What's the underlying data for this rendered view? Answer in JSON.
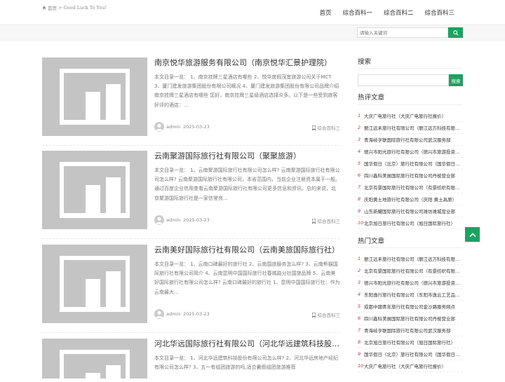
{
  "nav": {
    "items": [
      "首页",
      "综合百科一",
      "综合百科二",
      "综合百科三"
    ]
  },
  "breadcrumb": {
    "home": "首页",
    "separator": ">",
    "current": "Good Luck To You!"
  },
  "top_search": {
    "placeholder": "请输入关键词"
  },
  "posts": [
    {
      "title": "南京悦华旅游服务有限公司（南京悦华汇景护理院）",
      "excerpt": "本文目录一览： 1、南京挂牌三星酒店有哪些 2、悦华度假茂宜旅游公司关于MCT 3、厦门建发旅游集团股份有限公司概况 4、厦门建发旅游集团股份有限公司品牌介绍 南京挂牌三星酒店有哪些 您好，南京挂牌三星级酒店选择众多。以下是一些受到旅客好评的酒店：...",
      "author": "admin",
      "date": "2025-03-23",
      "category": "综合百科三"
    },
    {
      "title": "云南聚游国际旅行社有限公司（聚聚旅游）",
      "excerpt": "本文目录一览： 1、云南聚游国际旅行社有限公司怎么样? 云南聚游国际旅行社有限公司怎么样? 云南聚游国际旅行社有限公司，本省范围内，当前企业注册资本属于一般。通过百度企业信用查看云南聚游国际旅行社有限公司更多信息和资讯。总的来说，北京聚游国际旅行社是一家信誉良...",
      "author": "admin",
      "date": "2025-03-23",
      "category": "综合百科三"
    },
    {
      "title": "云南美好国际旅行社有限公司（云南美旅国际旅行社）",
      "excerpt": "本文目录一览： 1、云南口碑最好的旅行社 2、云南国旅服务怎么样? 3、云南熊猫国际旅行社有限公司简介 4、云南昆明中国国际旅行社春城路分社国旅品牌 5、云南美好国际旅行社有限公司怎么样? 云南口碑最好的旅行社 1、昆明中国国际旅行社：作为云南最大...",
      "author": "admin",
      "date": "2025-03-23",
      "category": "综合百科三"
    },
    {
      "title": "河北华远国际旅行社有限公司（河北华远建筑科技股份有限公司）",
      "excerpt": "本文目录一览： 1、河北华远建筑科技股份有限公司怎么样? 2、河北华远房地产经纪有限公司怎么样? 3、五一有组团旅游的吗,适合暑假组团旅游推荐",
      "author": "admin",
      "date": "2025-03-23",
      "category": "综合百科三"
    }
  ],
  "sidebar": {
    "search_title": "搜索",
    "search_button": "搜索",
    "hot_comments_title": "热评文章",
    "hot_comments": [
      {
        "num": "1",
        "text": "大庆广电旅行社（大庆广电旅行社报价）"
      },
      {
        "num": "2",
        "text": "丽江远禾旅行社有限公司（丽江远方科技有限公司）"
      },
      {
        "num": "3",
        "text": "青海岐亨联国际旅行社有限公司武汉服务部"
      },
      {
        "num": "4",
        "text": "德兴市阳光旅行社有限公司（德兴市旅游投资公司）"
      },
      {
        "num": "5",
        "text": "国华假日（北京）旅行社有限公司（国华假日旅行社）"
      },
      {
        "num": "6",
        "text": "四川鑫科美展国际旅行社有限公司丹棱营业部"
      },
      {
        "num": "7",
        "text": "北京有景国际旅行社有限公司（有景纺织有限公司）"
      },
      {
        "num": "8",
        "text": "庆阳黄土地旅行社有限公司（庆阳 黄土高原）"
      },
      {
        "num": "9",
        "text": "山东新耀国际旅行社有限公司潍坊潍城营业部"
      },
      {
        "num": "10",
        "text": "北京旭日旅行社有限公司（旭日国际旅行社）"
      }
    ],
    "hot_posts_title": "热门文章",
    "hot_posts": [
      {
        "num": "1",
        "text": "丽江远禾旅行社有限公司（丽江远方科技有限公司）"
      },
      {
        "num": "2",
        "text": "北京有景国际旅行社有限公司（有景纺织有限公司）"
      },
      {
        "num": "3",
        "text": "德兴市阳光旅行社有限公司（德兴市旅游投资公司）"
      },
      {
        "num": "4",
        "text": "东阳逸行旅行社有限公司（东阳市逸云工艺品有限公司）"
      },
      {
        "num": "5",
        "text": "成都中國青年旅行社有限公司金沙路服务网点"
      },
      {
        "num": "6",
        "text": "四川鑫科美展国际旅行社有限公司丹棱营业部"
      },
      {
        "num": "7",
        "text": "青海岐亨联国际旅行社有限公司武汉服务部"
      },
      {
        "num": "8",
        "text": "北京旭日旅行社有限公司（旭日国际旅行社）"
      },
      {
        "num": "9",
        "text": "国华假日（北京）旅行社有限公司（国华假日旅行社）"
      },
      {
        "num": "10",
        "text": "大庆广电旅行社（大庆广电旅行社报价）"
      }
    ]
  },
  "colors": {
    "accent": "#1aa361",
    "rank_num": "#c0392b",
    "thumb_bg": "#c4c4c4"
  }
}
